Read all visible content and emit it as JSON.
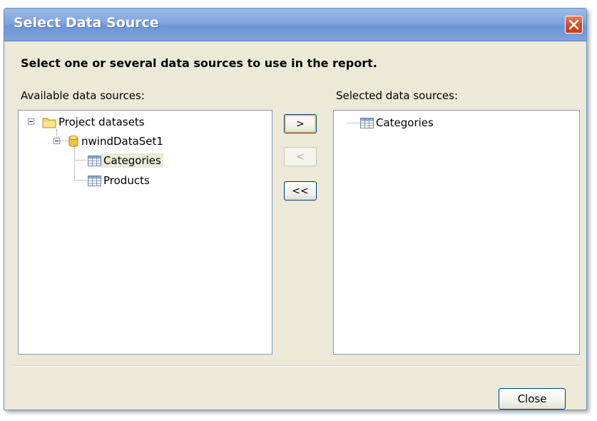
{
  "dialog": {
    "title": "Select Data Source",
    "heading": "Select one or several data sources to use in the report.",
    "available_label": "Available data sources:",
    "selected_label": "Selected data sources:",
    "close_label": "Close"
  },
  "available_tree": {
    "root": "Project datasets",
    "dataset": "nwindDataSet1",
    "tables": [
      "Categories",
      "Products"
    ],
    "selected_table": "Categories"
  },
  "selected_list": [
    "Categories"
  ],
  "move_buttons": {
    "add": ">",
    "remove": "<",
    "remove_all": "<<"
  },
  "colors": {
    "title_bar": "#7fa4de",
    "dialog_bg": "#ece9d8",
    "close_x": "#d64a24",
    "list_border": "#7f9db9"
  }
}
